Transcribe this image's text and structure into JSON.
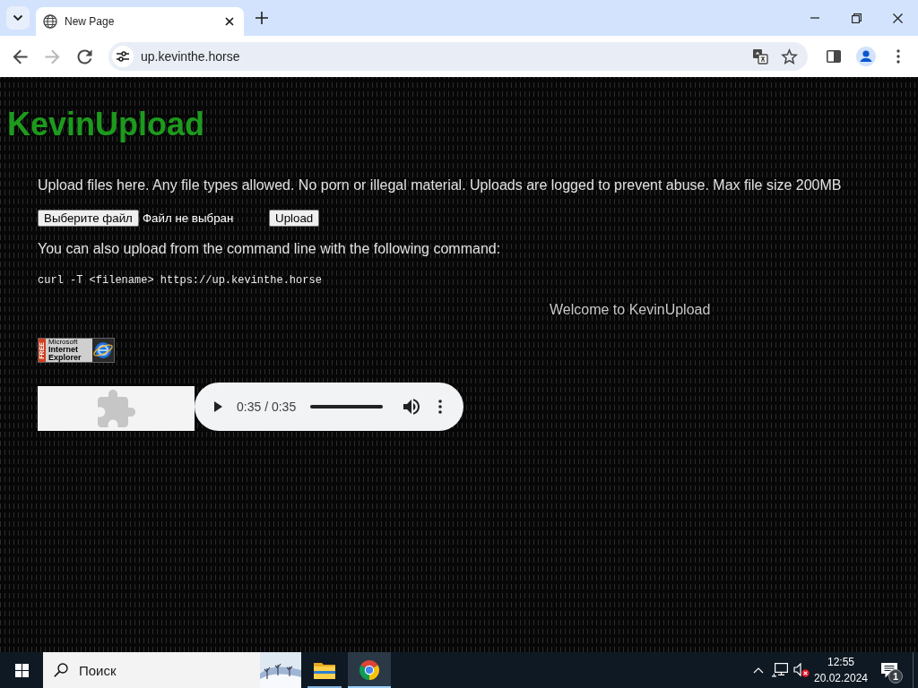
{
  "browser": {
    "tabs": [
      {
        "title": "New Page",
        "selected": true
      }
    ],
    "nav_buttons": [
      {
        "kind": "back",
        "disabled": false
      },
      {
        "kind": "forward",
        "disabled": true
      },
      {
        "kind": "reload",
        "disabled": false
      }
    ],
    "address": "up.kevinthe.horse"
  },
  "page": {
    "title": "KevinUpload",
    "intro": "Upload files here. Any file types allowed. No porn or illegal material. Uploads are logged to prevent abuse. Max file size 200MB",
    "file_button": "Выберите файл",
    "file_status": "Файл не выбран",
    "upload_button": "Upload",
    "cli_note": "You can also upload from the command line with the following command:",
    "command": "curl -T <filename> https://up.kevinthe.horse",
    "welcome": "Welcome to KevinUpload",
    "badge": {
      "ribbon": "FREE",
      "lines": [
        {
          "text": "Microsoft",
          "kind": "small"
        },
        {
          "text": "Internet",
          "kind": "bold"
        },
        {
          "text": "Explorer",
          "kind": "bold"
        }
      ]
    },
    "audio": {
      "time": "0:35 / 0:35",
      "level": 1
    }
  },
  "taskbar": {
    "search_placeholder": "Поиск",
    "apps": [
      {
        "kind": "explorer",
        "selected": false
      },
      {
        "kind": "chrome",
        "selected": true
      }
    ],
    "time": "12:55",
    "date": "20.02.2024",
    "notification_count": "1"
  }
}
